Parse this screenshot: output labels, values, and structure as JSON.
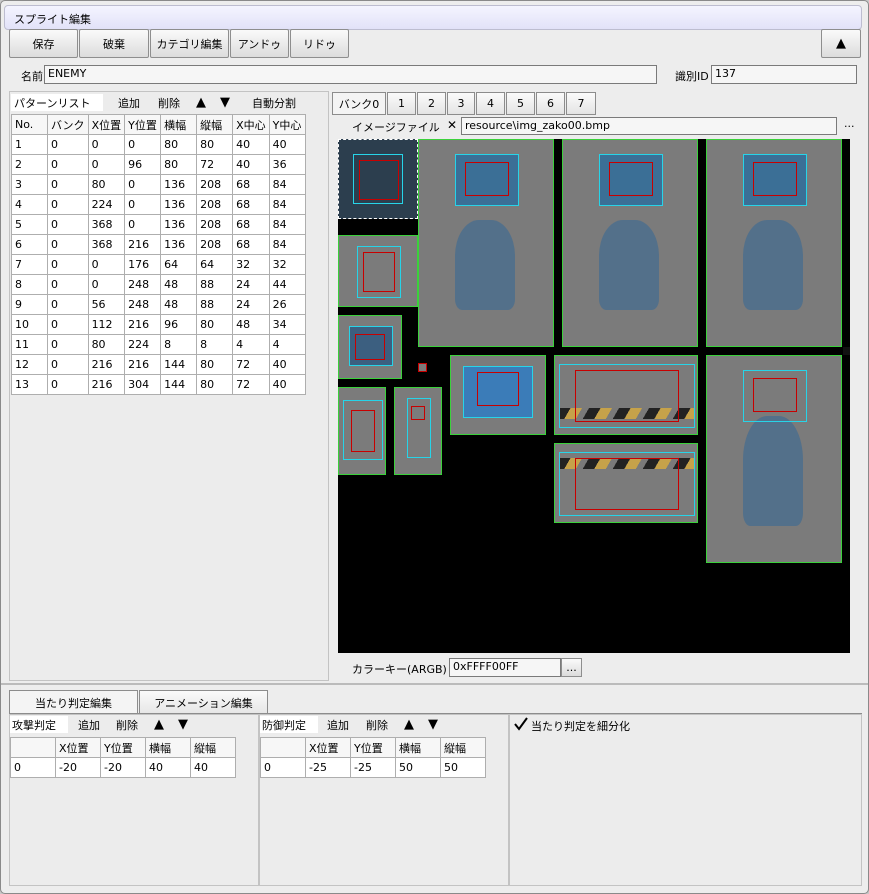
{
  "window": {
    "title": "スプライト編集"
  },
  "toolbar": {
    "save": "保存",
    "discard": "破棄",
    "category_edit": "カテゴリ編集",
    "undo": "アンドゥ",
    "redo": "リドゥ",
    "collapse": "▲"
  },
  "name_field": {
    "label": "名前",
    "value": "ENEMY"
  },
  "id_field": {
    "label": "識別ID",
    "value": "137"
  },
  "pattern_list": {
    "tab": "パターンリスト",
    "add": "追加",
    "delete": "削除",
    "up": "▲",
    "down": "▼",
    "auto_split": "自動分割",
    "columns": [
      "No.",
      "バンク",
      "X位置",
      "Y位置",
      "横幅",
      "縦幅",
      "X中心",
      "Y中心"
    ],
    "rows": [
      [
        "1",
        "0",
        "0",
        "0",
        "80",
        "80",
        "40",
        "40"
      ],
      [
        "2",
        "0",
        "0",
        "96",
        "80",
        "72",
        "40",
        "36"
      ],
      [
        "3",
        "0",
        "80",
        "0",
        "136",
        "208",
        "68",
        "84"
      ],
      [
        "4",
        "0",
        "224",
        "0",
        "136",
        "208",
        "68",
        "84"
      ],
      [
        "5",
        "0",
        "368",
        "0",
        "136",
        "208",
        "68",
        "84"
      ],
      [
        "6",
        "0",
        "368",
        "216",
        "136",
        "208",
        "68",
        "84"
      ],
      [
        "7",
        "0",
        "0",
        "176",
        "64",
        "64",
        "32",
        "32"
      ],
      [
        "8",
        "0",
        "0",
        "248",
        "48",
        "88",
        "24",
        "44"
      ],
      [
        "9",
        "0",
        "56",
        "248",
        "48",
        "88",
        "24",
        "26"
      ],
      [
        "10",
        "0",
        "112",
        "216",
        "96",
        "80",
        "48",
        "34"
      ],
      [
        "11",
        "0",
        "80",
        "224",
        "8",
        "8",
        "4",
        "4"
      ],
      [
        "12",
        "0",
        "216",
        "216",
        "144",
        "80",
        "72",
        "40"
      ],
      [
        "13",
        "0",
        "216",
        "304",
        "144",
        "80",
        "72",
        "40"
      ]
    ]
  },
  "banks": {
    "tabs": [
      "バンク0",
      "1",
      "2",
      "3",
      "4",
      "5",
      "6",
      "7"
    ]
  },
  "image_file": {
    "label": "イメージファイル",
    "close": "✕",
    "value": "resource\\img_zako00.bmp",
    "browse": "..."
  },
  "color_key": {
    "label": "カラーキー(ARGB)",
    "value": "0xFFFF00FF",
    "browse": "..."
  },
  "bottom_tabs": {
    "hit_edit": "当たり判定編集",
    "anim_edit": "アニメーション編集"
  },
  "attack": {
    "tab": "攻撃判定",
    "add": "追加",
    "delete": "削除",
    "up": "▲",
    "down": "▼",
    "columns": [
      "",
      "X位置",
      "Y位置",
      "横幅",
      "縦幅"
    ],
    "rows": [
      [
        "0",
        "-20",
        "-20",
        "40",
        "40"
      ]
    ]
  },
  "defense": {
    "tab": "防御判定",
    "add": "追加",
    "delete": "削除",
    "up": "▲",
    "down": "▼",
    "columns": [
      "",
      "X位置",
      "Y位置",
      "横幅",
      "縦幅"
    ],
    "rows": [
      [
        "0",
        "-25",
        "-25",
        "50",
        "50"
      ]
    ]
  },
  "subdivide": {
    "checked": true,
    "label": "当たり判定を細分化"
  },
  "colors": {
    "sprite_border": "#3bd13b",
    "hitbox_cyan": "#27d4e8",
    "hitbox_red": "#c80000"
  }
}
